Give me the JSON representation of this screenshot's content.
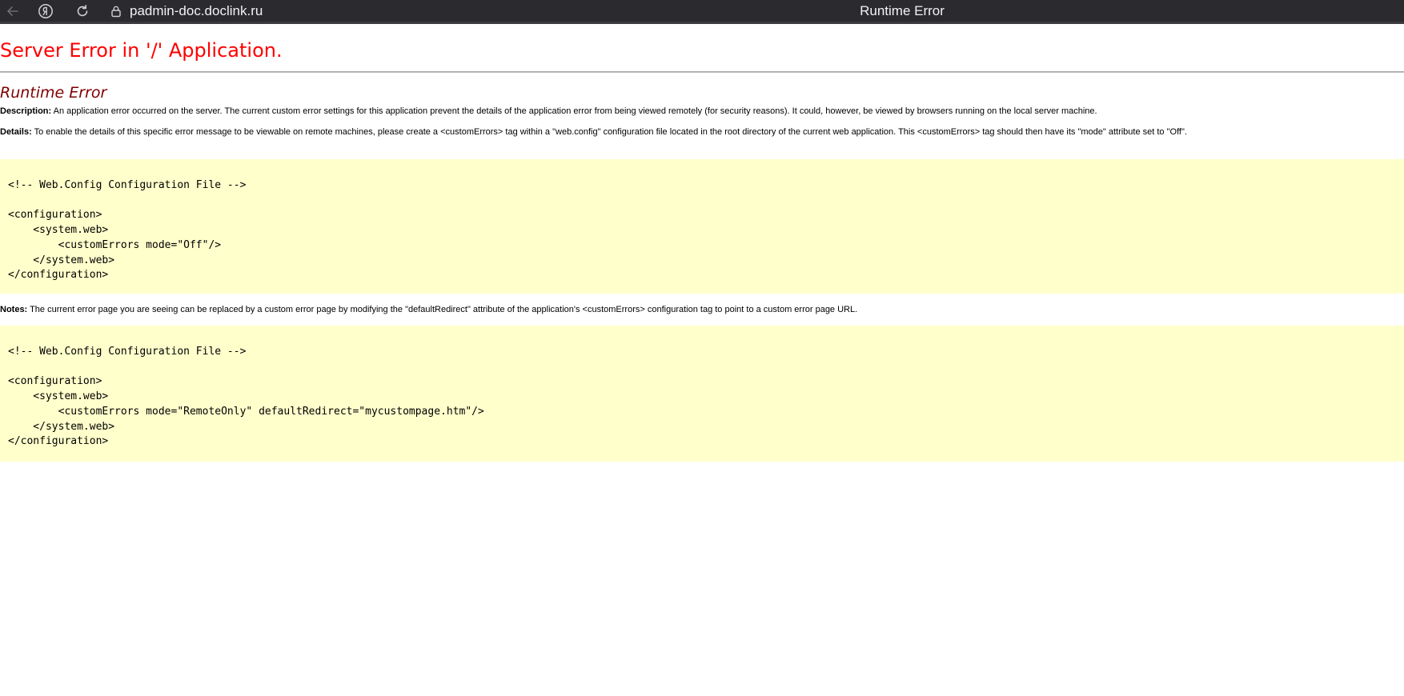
{
  "browser": {
    "url": "padmin-doc.doclink.ru",
    "tab_title": "Runtime Error"
  },
  "page": {
    "heading": "Server Error in '/' Application.",
    "subheading": "Runtime Error",
    "description_label": "Description:",
    "description_text": " An application error occurred on the server. The current custom error settings for this application prevent the details of the application error from being viewed remotely (for security reasons). It could, however, be viewed by browsers running on the local server machine.",
    "details_label": "Details:",
    "details_text": " To enable the details of this specific error message to be viewable on remote machines, please create a <customErrors> tag within a \"web.config\" configuration file located in the root directory of the current web application. This <customErrors> tag should then have its \"mode\" attribute set to \"Off\".",
    "code_block_1": "<!-- Web.Config Configuration File -->\n\n<configuration>\n    <system.web>\n        <customErrors mode=\"Off\"/>\n    </system.web>\n</configuration>",
    "notes_label": "Notes:",
    "notes_text": " The current error page you are seeing can be replaced by a custom error page by modifying the \"defaultRedirect\" attribute of the application's <customErrors> configuration tag to point to a custom error page URL.",
    "code_block_2": "<!-- Web.Config Configuration File -->\n\n<configuration>\n    <system.web>\n        <customErrors mode=\"RemoteOnly\" defaultRedirect=\"mycustompage.htm\"/>\n    </system.web>\n</configuration>"
  },
  "icons": {
    "back": "back-arrow-icon",
    "yandex": "yandex-logo-icon",
    "reload": "reload-icon",
    "lock": "lock-icon"
  }
}
